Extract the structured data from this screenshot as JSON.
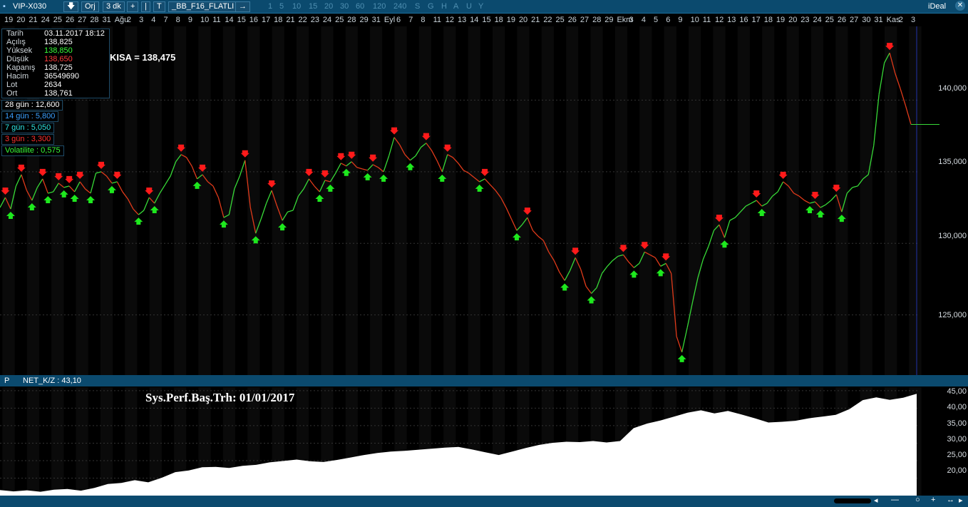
{
  "toolbar": {
    "symbol": "VIP-X030",
    "down_icon": "down-arrow-icon",
    "orj": "Orj",
    "period": "3 dk",
    "plus": "+",
    "pipe": "|",
    "t": "T",
    "template": "_BB_F16_FLATLI",
    "arrow": "→",
    "periods": [
      "1",
      "5",
      "10",
      "15",
      "20",
      "30",
      "60",
      "120",
      "240",
      "S",
      "G",
      "H",
      "A",
      "U",
      "Y"
    ],
    "brand": "iDeal"
  },
  "date_axis": [
    "19",
    "20",
    "21",
    "24",
    "25",
    "26",
    "27",
    "28",
    "31",
    "Ağu",
    "2",
    "3",
    "4",
    "7",
    "8",
    "9",
    "10",
    "11",
    "14",
    "15",
    "16",
    "17",
    "18",
    "21",
    "22",
    "23",
    "24",
    "25",
    "28",
    "29",
    "31",
    "Eyl",
    "6",
    "7",
    "8",
    "11",
    "12",
    "13",
    "14",
    "15",
    "18",
    "19",
    "20",
    "21",
    "22",
    "25",
    "26",
    "27",
    "28",
    "29",
    "Ekm",
    "3",
    "4",
    "5",
    "6",
    "9",
    "10",
    "11",
    "12",
    "13",
    "16",
    "17",
    "18",
    "19",
    "20",
    "23",
    "24",
    "25",
    "26",
    "27",
    "30",
    "31",
    "Kas",
    "2",
    "3"
  ],
  "info_panel": {
    "rows": [
      {
        "k": "Tarih",
        "v": "03.11.2017 18:12",
        "color": "#ffffff"
      },
      {
        "k": "Açılış",
        "v": "138,825",
        "color": "#ffffff"
      },
      {
        "k": "Yüksek",
        "v": "138,850",
        "color": "#39ff39"
      },
      {
        "k": "Düşük",
        "v": "138,650",
        "color": "#ff3b3b"
      },
      {
        "k": "Kapanış",
        "v": "138,725",
        "color": "#ffffff"
      },
      {
        "k": "Hacim",
        "v": "36549690",
        "color": "#ffffff"
      },
      {
        "k": "Lot",
        "v": "2634",
        "color": "#ffffff"
      },
      {
        "k": "Ort",
        "v": "138,761",
        "color": "#ffffff"
      }
    ]
  },
  "stats": [
    {
      "text": "28 gün : 12,600",
      "color": "#ffffff"
    },
    {
      "text": "14 gün : 5,800",
      "color": "#3aa0ff"
    },
    {
      "text": "7 gün : 5,050",
      "color": "#2ee6e6"
    },
    {
      "text": "3 gün : 3,300",
      "color": "#ff3030"
    },
    {
      "text": "Volatilite : 0,575",
      "color": "#39ff39"
    }
  ],
  "kisa_label": "KISA = 138,475",
  "price_axis": [
    "140,000",
    "135,000",
    "130,000",
    "125,000"
  ],
  "mid_bar": {
    "p": "P",
    "label": "NET_K/Z : 43,10"
  },
  "perf_title": "Sys.Perf.Baş.Trh:  01/01/2017",
  "perf_axis": [
    "45,00",
    "40,00",
    "35,00",
    "30,00",
    "25,00",
    "20,00"
  ],
  "colors": {
    "up": "#1ee81e",
    "down": "#ff1a1a",
    "line_up": "#37d937",
    "line_down": "#e03a1a",
    "toolbar": "#0b4a6e"
  },
  "chart_data": {
    "type": "line",
    "price_ylim": [
      121,
      145
    ],
    "price_series": [
      132.5,
      133.2,
      132.4,
      134.0,
      134.8,
      133.7,
      133.0,
      133.9,
      134.5,
      133.5,
      133.6,
      134.2,
      133.9,
      134.0,
      133.6,
      134.3,
      133.8,
      133.5,
      134.9,
      135.0,
      134.7,
      134.2,
      134.3,
      133.6,
      133.1,
      132.4,
      132.0,
      132.3,
      133.2,
      132.8,
      133.5,
      134.1,
      134.7,
      135.7,
      136.2,
      136.0,
      135.4,
      134.5,
      134.8,
      134.3,
      134.0,
      133.2,
      131.8,
      132.0,
      133.8,
      134.7,
      135.8,
      132.5,
      130.7,
      131.7,
      132.8,
      133.7,
      132.6,
      131.6,
      132.2,
      132.3,
      133.3,
      133.8,
      134.5,
      134.0,
      133.6,
      134.4,
      134.3,
      134.9,
      135.6,
      135.4,
      135.7,
      135.3,
      135.2,
      135.1,
      135.5,
      135.3,
      135.0,
      136.1,
      137.4,
      136.9,
      136.2,
      135.8,
      136.1,
      136.7,
      137.0,
      136.5,
      135.8,
      135.0,
      136.2,
      136.0,
      135.6,
      135.1,
      134.9,
      134.6,
      134.3,
      134.5,
      134.1,
      133.7,
      133.2,
      132.5,
      131.7,
      130.9,
      131.3,
      131.8,
      130.9,
      130.5,
      130.2,
      129.4,
      128.8,
      128.0,
      127.4,
      128.1,
      129.0,
      128.2,
      127.0,
      126.5,
      126.9,
      127.9,
      128.4,
      128.8,
      129.1,
      129.2,
      128.7,
      128.3,
      128.6,
      129.4,
      129.2,
      129.0,
      128.4,
      128.6,
      127.9,
      123.5,
      122.4,
      124.1,
      125.9,
      127.6,
      128.9,
      129.8,
      130.9,
      131.3,
      130.4,
      131.6,
      131.8,
      132.2,
      132.6,
      132.8,
      133.0,
      132.6,
      132.8,
      133.3,
      133.6,
      134.3,
      134.0,
      133.5,
      133.3,
      133.0,
      132.8,
      132.9,
      132.5,
      132.7,
      133.0,
      133.4,
      132.2,
      133.5,
      133.9,
      134.0,
      134.5,
      134.8,
      136.8,
      140.4,
      142.6,
      143.3,
      141.9,
      140.8,
      139.6,
      138.3
    ],
    "perf_ylim": [
      15,
      46
    ],
    "perf_series": [
      16.6,
      16.2,
      16.5,
      16.1,
      16.7,
      16.9,
      16.4,
      17.2,
      18.3,
      18.6,
      19.4,
      18.8,
      20.1,
      21.7,
      22.2,
      23.1,
      23.2,
      22.9,
      23.5,
      23.8,
      24.5,
      24.9,
      25.3,
      24.8,
      24.6,
      25.2,
      25.9,
      26.6,
      27.2,
      27.6,
      27.8,
      28.1,
      28.4,
      28.7,
      28.9,
      28.2,
      27.4,
      26.6,
      27.6,
      28.6,
      29.5,
      30.1,
      30.4,
      30.3,
      30.6,
      30.2,
      30.6,
      34.3,
      35.6,
      36.5,
      37.6,
      38.7,
      39.4,
      38.5,
      39.2,
      38.2,
      37.1,
      35.9,
      36.1,
      36.4,
      37.1,
      37.6,
      38.1,
      39.7,
      42.3,
      43.1,
      42.4,
      43.0,
      44.1
    ]
  }
}
